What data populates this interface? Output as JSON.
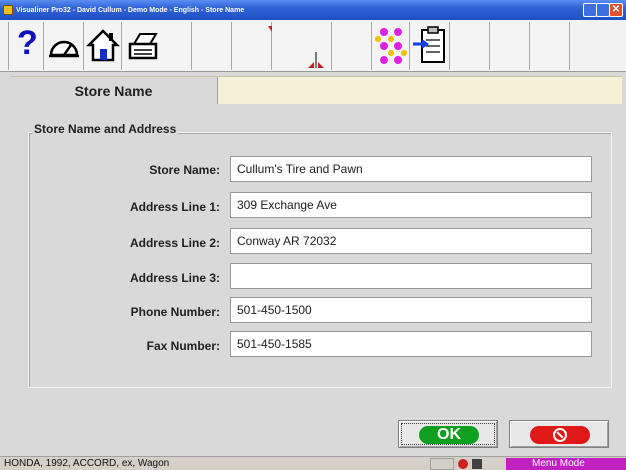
{
  "window": {
    "title": "Visualiner Pro32 - David Cullum - Demo Mode - English - Store Name"
  },
  "toolbar": {
    "help_label": "?",
    "icons": [
      "help-icon",
      "gauge-icon",
      "home-icon",
      "printer-icon",
      "blank-toolbar-button",
      "blank-toolbar-button",
      "blank-toolbar-button",
      "dots-pattern-icon",
      "clipboard-arrow-icon"
    ]
  },
  "tab": {
    "label": "Store Name"
  },
  "group": {
    "title": "Store Name and Address"
  },
  "form": {
    "rows": [
      {
        "label": "Store Name:",
        "value": "Cullum's Tire and Pawn"
      },
      {
        "label": "Address Line 1:",
        "value": "309 Exchange Ave"
      },
      {
        "label": "Address Line 2:",
        "value": "Conway AR 72032"
      },
      {
        "label": "Address Line 3:",
        "value": ""
      },
      {
        "label": "Phone Number:",
        "value": "501-450-1500"
      },
      {
        "label": "Fax Number:",
        "value": "501-450-1585"
      }
    ]
  },
  "buttons": {
    "ok_label": "OK"
  },
  "status": {
    "vehicle": "HONDA, 1992, ACCORD, ex, Wagon",
    "mode": "Menu Mode"
  },
  "colors": {
    "accent_green": "#10a020",
    "accent_red": "#e01818",
    "status_mode": "#c020c0"
  }
}
